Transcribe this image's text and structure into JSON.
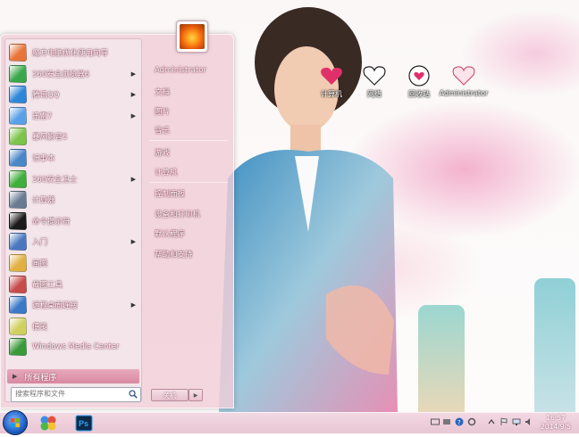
{
  "desktop": {
    "icons": [
      {
        "label": "计算机",
        "icon": "heart-icon"
      },
      {
        "label": "网络",
        "icon": "love-ever-icon"
      },
      {
        "label": "回收站",
        "icon": "love-badge-icon"
      },
      {
        "label": "Administrator",
        "icon": "love-you-icon"
      }
    ]
  },
  "start_menu": {
    "programs": [
      {
        "label": "魔方电脑优化使用向导",
        "icon": "cube-icon",
        "color": "#e8743a",
        "arrow": false
      },
      {
        "label": "360安全浏览器6",
        "icon": "browser-icon",
        "color": "#3aa84a",
        "arrow": true
      },
      {
        "label": "腾讯QQ",
        "icon": "qq-icon",
        "color": "#2f86d8",
        "arrow": true
      },
      {
        "label": "迅雷7",
        "icon": "thunder-icon",
        "color": "#5aa0e6",
        "arrow": true
      },
      {
        "label": "暴风影音5",
        "icon": "baofeng-icon",
        "color": "#7cc44a",
        "arrow": false
      },
      {
        "label": "记事本",
        "icon": "notepad-icon",
        "color": "#4a86c8",
        "arrow": false
      },
      {
        "label": "360安全卫士",
        "icon": "shield-plus-icon",
        "color": "#3fae3a",
        "arrow": true
      },
      {
        "label": "计算器",
        "icon": "calculator-icon",
        "color": "#6a7c94",
        "arrow": false
      },
      {
        "label": "命令提示符",
        "icon": "cmd-icon",
        "color": "#1a1a1a",
        "arrow": false
      },
      {
        "label": "入门",
        "icon": "getting-started-icon",
        "color": "#4a78c0",
        "arrow": true
      },
      {
        "label": "画图",
        "icon": "paint-icon",
        "color": "#e0b040",
        "arrow": false
      },
      {
        "label": "截图工具",
        "icon": "scissors-icon",
        "color": "#c84a4a",
        "arrow": false
      },
      {
        "label": "远程桌面连接",
        "icon": "remote-desktop-icon",
        "color": "#3a78c8",
        "arrow": true
      },
      {
        "label": "便笺",
        "icon": "sticky-notes-icon",
        "color": "#d0d060",
        "arrow": false
      },
      {
        "label": "Windows Media Center",
        "icon": "media-center-icon",
        "color": "#3a9a3a",
        "arrow": false
      }
    ],
    "all_programs": "所有程序",
    "search_placeholder": "搜索程序和文件",
    "right_items": [
      {
        "label": "Administrator"
      },
      {
        "label": "文档"
      },
      {
        "label": "图片"
      },
      {
        "label": "音乐"
      },
      {
        "label": "游戏"
      },
      {
        "label": "计算机"
      },
      {
        "label": "控制面板"
      },
      {
        "label": "设备和打印机"
      },
      {
        "label": "默认程序"
      },
      {
        "label": "帮助和支持"
      }
    ],
    "shutdown_label": "关机"
  },
  "taskbar": {
    "pinned": [
      {
        "icon": "dotcolor-icon"
      },
      {
        "icon": "photoshop-icon",
        "label": "Ps"
      }
    ],
    "clock_time": "16:57",
    "clock_date": "2014/9/5"
  }
}
